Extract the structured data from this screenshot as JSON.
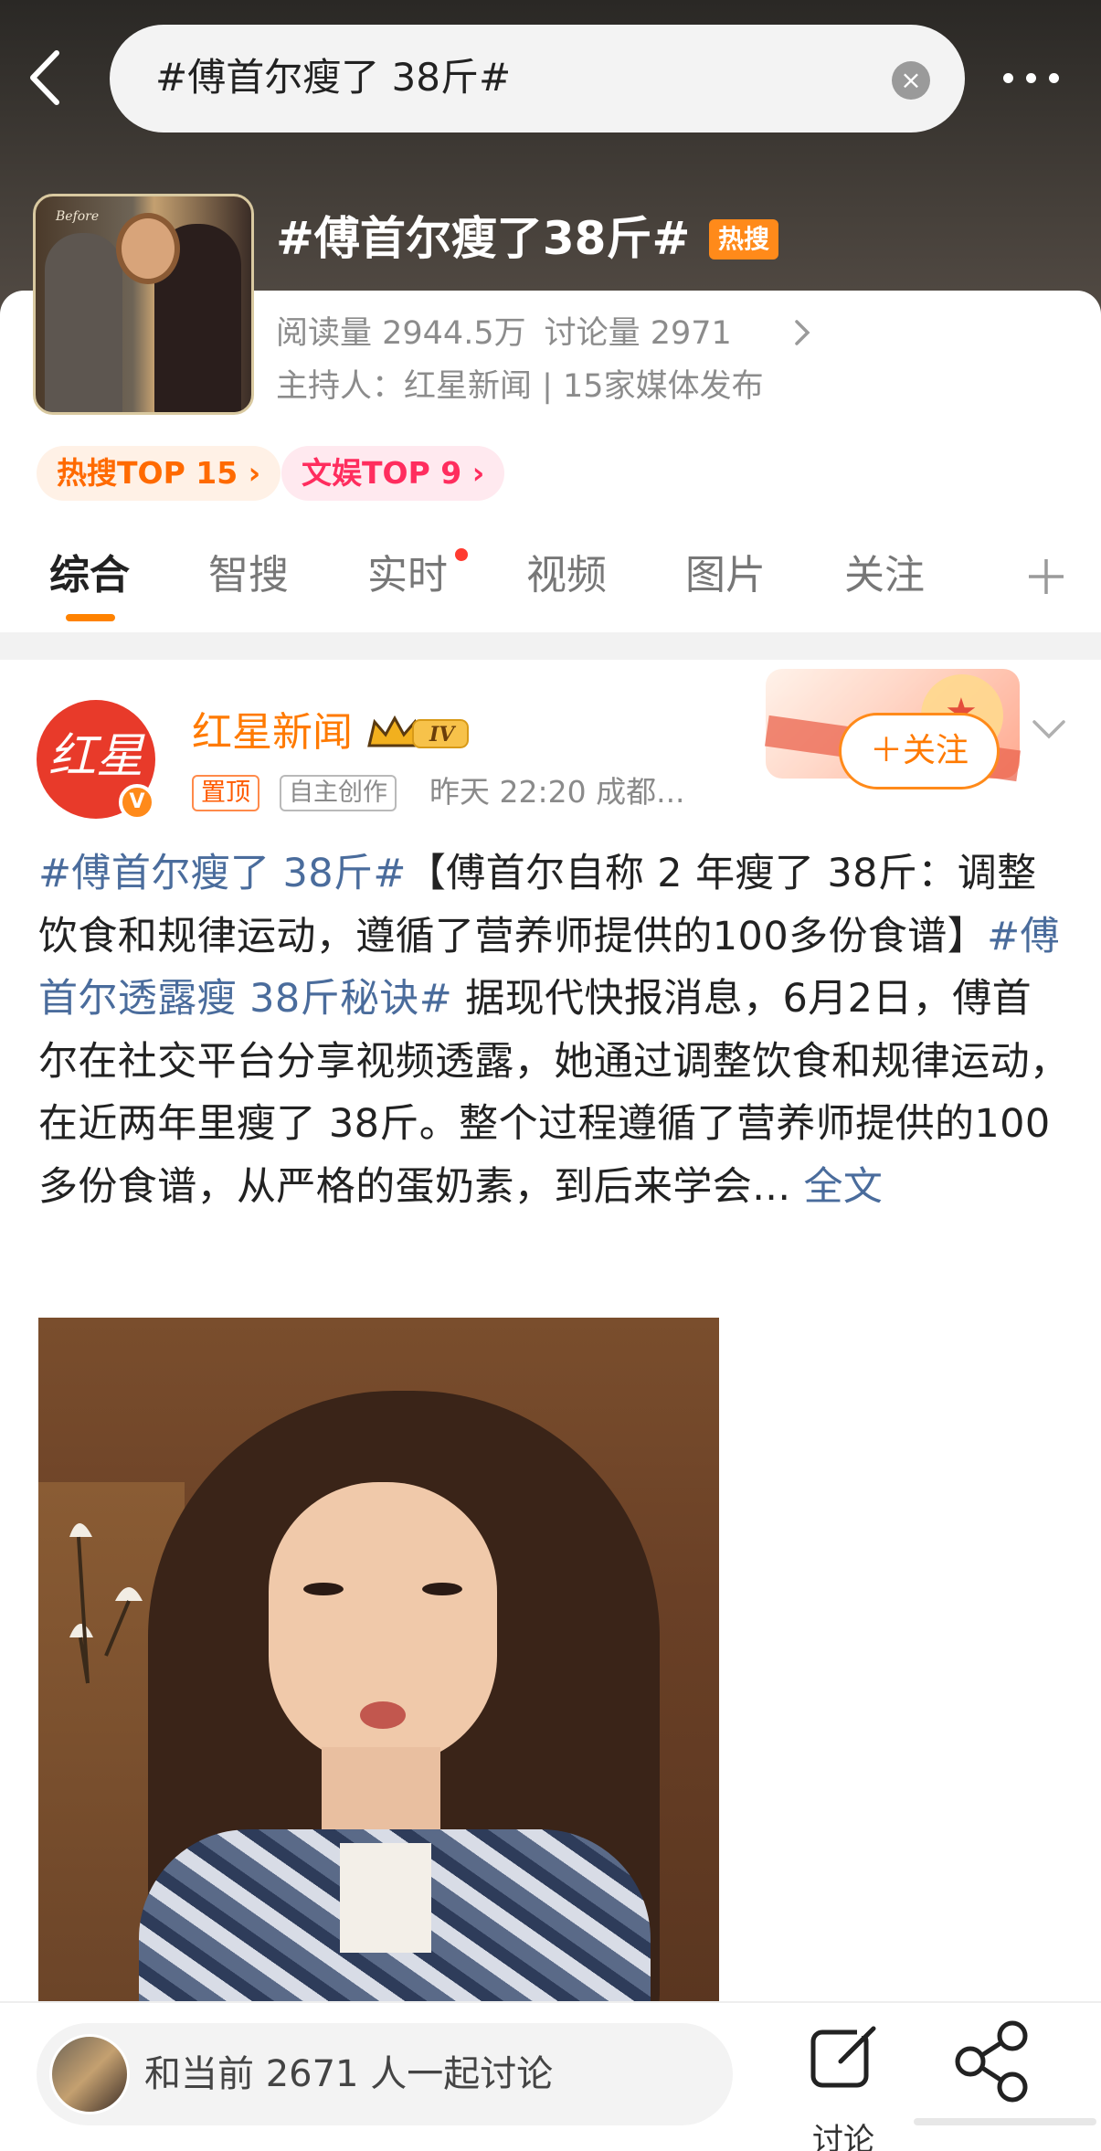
{
  "search": {
    "query": "#傅首尔瘦了 38斤#",
    "clear_label": "×"
  },
  "topic": {
    "title": "#傅首尔瘦了38斤#",
    "hot_badge": "热搜",
    "reads": "阅读量 2944.5万",
    "discussions": "讨论量 2971",
    "host": "主持人：红星新闻 | 15家媒体发布",
    "cover_caption": "Before",
    "rank_hot": "热搜TOP 15 ›",
    "rank_ent": "文娱TOP 9 ›"
  },
  "tabs": [
    {
      "label": "综合"
    },
    {
      "label": "智搜"
    },
    {
      "label": "实时"
    },
    {
      "label": "视频"
    },
    {
      "label": "图片"
    },
    {
      "label": "关注"
    }
  ],
  "post": {
    "avatar_text": "红星",
    "verified_badge": "V",
    "author": "红星新闻",
    "level_badge": "IV",
    "pinned": "置顶",
    "original": "自主创作",
    "meta": "昨天 22:20  成都...",
    "follow_label": "＋关注",
    "hashtag1": "#傅首尔瘦了 38斤#",
    "text1": "【傅首尔自称 2 年瘦了 38斤：调整饮食和规律运动，遵循了营养师提供的100多份食谱】",
    "hashtag2": "#傅首尔透露瘦 38斤秘诀#",
    "text2": " 据现代快报消息，6月2日，傅首尔在社交平台分享视频透露，她通过调整饮食和规律运动，在近两年里瘦了 38斤。整个过程遵循了营养师提供的100多份食谱，从严格的蛋奶素，到后来学会...",
    "full_text_link": " 全文"
  },
  "bottom": {
    "discuss_placeholder": "和当前 2671 人一起讨论",
    "discuss_label": "讨论",
    "share_label": ""
  },
  "colors": {
    "accent_orange": "#ff8200",
    "link_blue": "#4a6c9c",
    "hot_badge": "#ff8a1a",
    "ent_pink": "#ff2d5e"
  }
}
